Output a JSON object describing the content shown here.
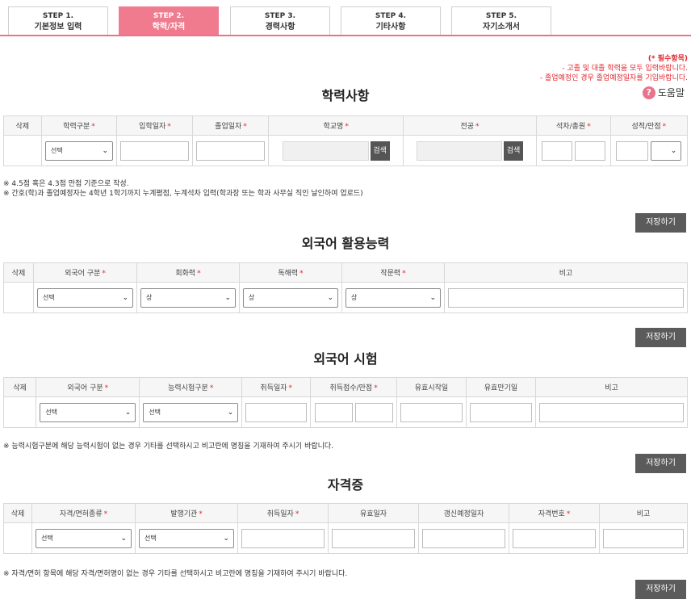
{
  "tabs": [
    {
      "step": "STEP 1.",
      "label": "기본정보 입력",
      "active": false
    },
    {
      "step": "STEP 2.",
      "label": "학력/자격",
      "active": true
    },
    {
      "step": "STEP 3.",
      "label": "경력사항",
      "active": false
    },
    {
      "step": "STEP 4.",
      "label": "기타사항",
      "active": false
    },
    {
      "step": "STEP 5.",
      "label": "자기소개서",
      "active": false
    }
  ],
  "notice": {
    "required": "(* 필수항목)",
    "line1": "- 고졸 및 대졸 학력을 모두 입력바랍니다.",
    "line2": "- 졸업예정인 경우 졸업예정일자를 기입바랍니다.",
    "help": "도움말"
  },
  "education": {
    "title": "학력사항",
    "headers": [
      "삭제",
      "학력구분",
      "입학일자",
      "졸업일자",
      "학교명",
      "전공",
      "석차/총원",
      "성적/만점"
    ],
    "select_value": "선택",
    "search_label": "검색",
    "notes": [
      "※ 4.5점 혹은 4.3점 만점 기준으로 작성.",
      "※ 간호(학)과 졸업예정자는 4학년 1학기까지 누계평점, 누계석차 입력(학과장 또는 학과 사무실 직인 날인하여 업로드)"
    ],
    "save": "저장하기"
  },
  "language_skill": {
    "title": "외국어 활용능력",
    "headers": [
      "삭제",
      "외국어 구분",
      "회화력",
      "독해력",
      "작문력",
      "비고"
    ],
    "select_lang": "선택",
    "level": "상",
    "save": "저장하기"
  },
  "language_test": {
    "title": "외국어 시험",
    "headers": [
      "삭제",
      "외국어 구분",
      "능력시험구분",
      "취득일자",
      "취득점수/만점",
      "유효시작일",
      "유효만기일",
      "비고"
    ],
    "select1": "선택",
    "select2": "선택",
    "note": "※ 능력시험구분에 해당 능력시험이 없는 경우 기타를 선택하시고 비고란에 명칭을 기재하여 주시기 바랍니다.",
    "save": "저장하기"
  },
  "license": {
    "title": "자격증",
    "headers": [
      "삭제",
      "자격/면허종류",
      "발행기관",
      "취득일자",
      "유효일자",
      "갱신예정일자",
      "자격번호",
      "비고"
    ],
    "select1": "선택",
    "select2": "선택",
    "note": "※ 자격/면허 항목에 해당 자격/면허명이 없는 경우 기타를 선택하시고 비고란에 명칭을 기재하여 주시기 바랍니다.",
    "save": "저장하기"
  }
}
